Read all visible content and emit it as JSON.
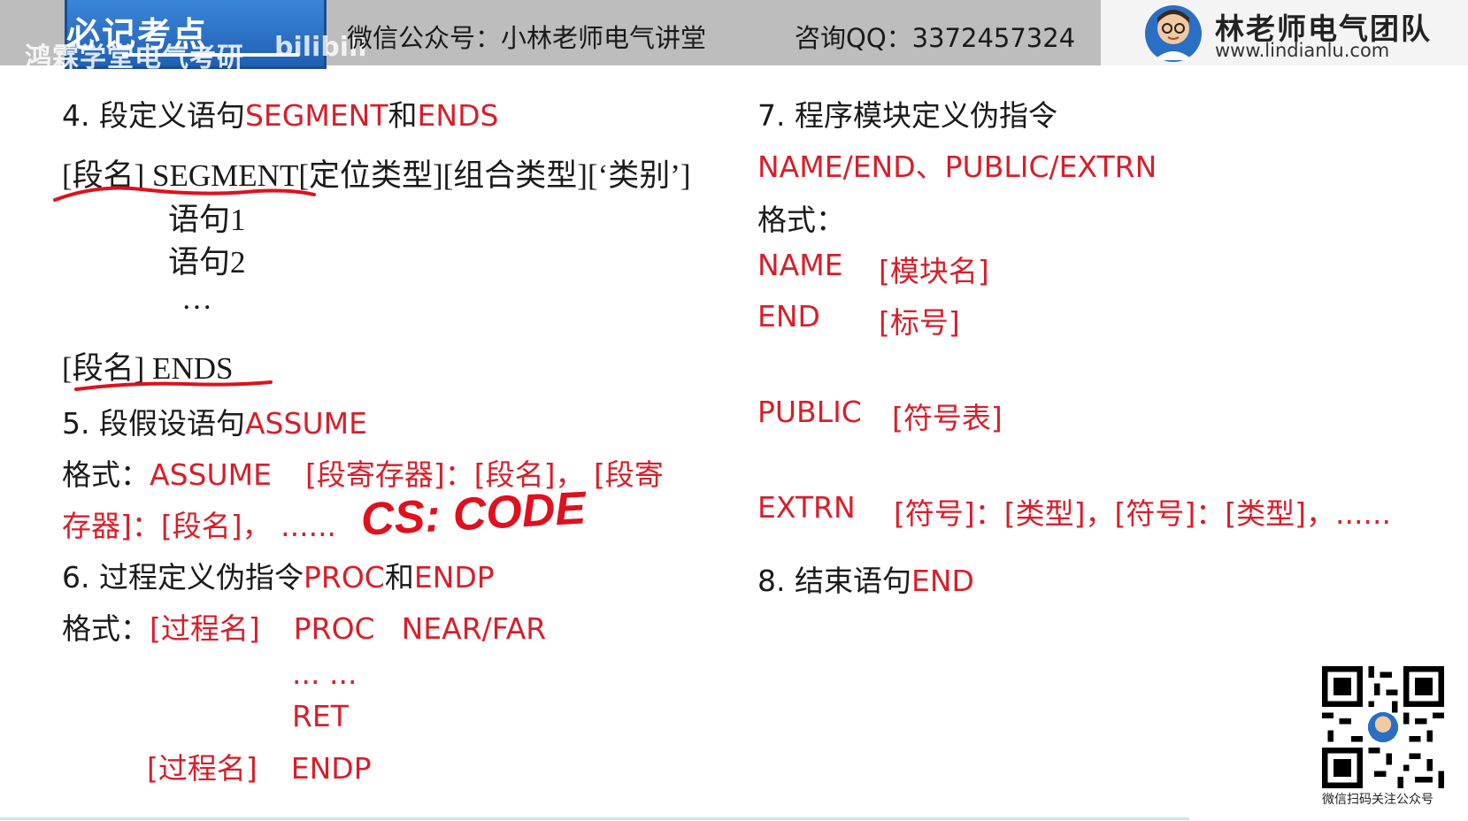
{
  "header": {
    "badge": "必记考点",
    "watermark": "鸿霖学堂电气考研",
    "bili": "bilibili",
    "wechat": "微信公众号：小林老师电气讲堂",
    "qq": "咨询QQ：3372457324",
    "brand_name": "林老师电气团队",
    "brand_url": "www.lindianlu.com"
  },
  "left": {
    "s4_num": "4. 段定义语句",
    "s4_kw": "SEGMENT",
    "s4_and": "和",
    "s4_kw2": "ENDS",
    "seg_line": "[段名]  SEGMENT[定位类型][组合类型][‘类别’]",
    "stmt1": "语句1",
    "stmt2": "语句2",
    "dots": "…",
    "ends_line": "[段名]  ENDS",
    "s5_num": "5. 段假设语句",
    "s5_kw": "ASSUME",
    "s5_fmt_label": "格式：",
    "s5_fmt_1": "ASSUME",
    "s5_fmt_2": "[段寄存器]：[段名]， [段寄",
    "s5_fmt_3": "存器]：[段名]， ......",
    "s6_num": "6. 过程定义伪指令",
    "s6_kw": "PROC",
    "s6_and": "和",
    "s6_kw2": "ENDP",
    "s6_fmt_label": "格式：",
    "s6_fmt_name": "[过程名]",
    "s6_fmt_proc": "PROC",
    "s6_fmt_nf": "NEAR/FAR",
    "s6_dots": "...   ...",
    "s6_ret": "RET",
    "s6_end_name": "[过程名]",
    "s6_endp": "ENDP"
  },
  "right": {
    "s7_title": "7. 程序模块定义伪指令",
    "s7_kw": "NAME/END、PUBLIC/EXTRN",
    "s7_fmt": "格式：",
    "name_kw": "NAME",
    "name_arg": "[模块名]",
    "end_kw": "END",
    "end_arg": "[标号]",
    "public_kw": "PUBLIC",
    "public_arg": "[符号表]",
    "extrn_kw": "EXTRN",
    "extrn_arg": "[符号]：[类型]，[符号]：[类型]，......",
    "s8_num": "8. 结束语句",
    "s8_kw": "END"
  },
  "annotation": {
    "handwritten": "CS: CODE"
  },
  "qr": {
    "caption": "微信扫码关注公众号"
  },
  "colors": {
    "keyword": "#d81e2a",
    "header_bg": "#bdbdbd",
    "badge": "#2a6fc4",
    "annotation": "#e0101e"
  }
}
